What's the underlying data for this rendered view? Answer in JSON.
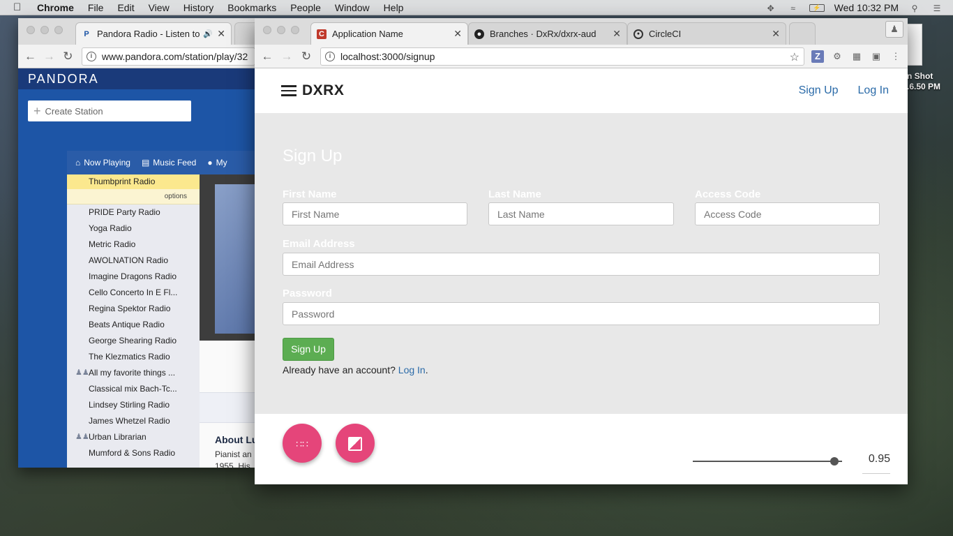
{
  "menubar": {
    "app_name": "Chrome",
    "items": [
      "File",
      "Edit",
      "View",
      "History",
      "Bookmarks",
      "People",
      "Window",
      "Help"
    ],
    "clock": "Wed 10:32 PM"
  },
  "desktop": {
    "screenshot_label_line1": "n Shot",
    "screenshot_label_line2": ".6.50 PM"
  },
  "back_window": {
    "tab_title": "Pandora Radio - Listen to Fr",
    "url": "www.pandora.com/station/play/32",
    "logo": "PANDORA",
    "create_station": "Create Station",
    "nav": [
      "Now Playing",
      "Music Feed",
      "My"
    ],
    "stations": [
      {
        "name": "Thumbprint Radio",
        "active": true,
        "shared": false
      },
      {
        "name": "PRIDE Party Radio",
        "shared": false
      },
      {
        "name": "Yoga Radio",
        "shared": false
      },
      {
        "name": "Metric Radio",
        "shared": false
      },
      {
        "name": "AWOLNATION Radio",
        "shared": false
      },
      {
        "name": "Imagine Dragons Radio",
        "shared": false
      },
      {
        "name": "Cello Concerto In E Fl...",
        "shared": false
      },
      {
        "name": "Regina Spektor Radio",
        "shared": false
      },
      {
        "name": "Beats Antique Radio",
        "shared": false
      },
      {
        "name": "George Shearing Radio",
        "shared": false
      },
      {
        "name": "The Klezmatics Radio",
        "shared": false
      },
      {
        "name": "All my favorite things ...",
        "shared": true
      },
      {
        "name": "Classical mix Bach-Tc...",
        "shared": false
      },
      {
        "name": "Lindsey Stirling Radio",
        "shared": false
      },
      {
        "name": "James Whetzel Radio",
        "shared": false
      },
      {
        "name": "Urban Librarian",
        "shared": true
      },
      {
        "name": "Mumford & Sons Radio",
        "shared": false
      }
    ],
    "options_label": "options",
    "about_heading": "About Lu",
    "about_text_1": "Pianist an",
    "about_text_2": "1955. His"
  },
  "front_window": {
    "tabs": [
      {
        "title": "Application Name",
        "active": true
      },
      {
        "title": "Branches · DxRx/dxrx-aud",
        "active": false
      },
      {
        "title": "CircleCI",
        "active": false
      }
    ],
    "url": "localhost:3000/signup",
    "brand": "DXRX",
    "nav_signup": "Sign Up",
    "nav_login": "Log In",
    "form": {
      "title": "Sign Up",
      "first_name_label": "First Name",
      "first_name_placeholder": "First Name",
      "last_name_label": "Last Name",
      "last_name_placeholder": "Last Name",
      "access_code_label": "Access Code",
      "access_code_placeholder": "Access Code",
      "email_label": "Email Address",
      "email_placeholder": "Email Address",
      "password_label": "Password",
      "password_placeholder": "Password",
      "submit_label": "Sign Up",
      "already_text": "Already have an account?",
      "login_link": "Log In",
      "period": "."
    },
    "slider": {
      "value": "0.95",
      "fraction": 0.95
    },
    "colors": {
      "fab": "#e5457a",
      "submit": "#5cad52",
      "link": "#2a6aa8"
    }
  }
}
